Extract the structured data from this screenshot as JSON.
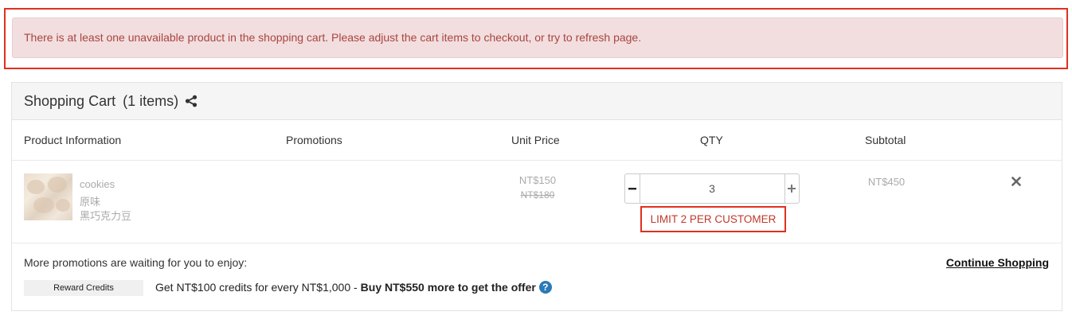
{
  "alert": {
    "message": "There is at least one unavailable product in the shopping cart. Please adjust the cart items to checkout, or try to refresh page."
  },
  "cart": {
    "title": "Shopping Cart",
    "count": "(1 items)",
    "columns": {
      "product": "Product Information",
      "promotions": "Promotions",
      "unit_price": "Unit Price",
      "qty": "QTY",
      "subtotal": "Subtotal"
    },
    "items": [
      {
        "name": "cookies",
        "variant1": "原味",
        "variant2": "黑巧克力豆",
        "price": "NT$150",
        "original_price": "NT$180",
        "quantity": "3",
        "limit_notice": "LIMIT 2 PER CUSTOMER",
        "subtotal": "NT$450"
      }
    ]
  },
  "promotions": {
    "heading": "More promotions are waiting for you to enjoy:",
    "continue_label": "Continue Shopping",
    "reward_tag": "Reward Credits",
    "offer_text": "Get NT$100 credits for every NT$1,000 -",
    "offer_bold": "Buy NT$550 more to get the offer",
    "help_glyph": "?"
  },
  "icons": {
    "share": "share-icon",
    "remove": "close-icon",
    "minus": "minus-icon",
    "plus": "plus-icon",
    "help": "question-circle-icon"
  },
  "colors": {
    "alert_bg": "#f2dede",
    "alert_text": "#a94442",
    "highlight": "#e0301e",
    "help_blue": "#2a7ab8"
  }
}
